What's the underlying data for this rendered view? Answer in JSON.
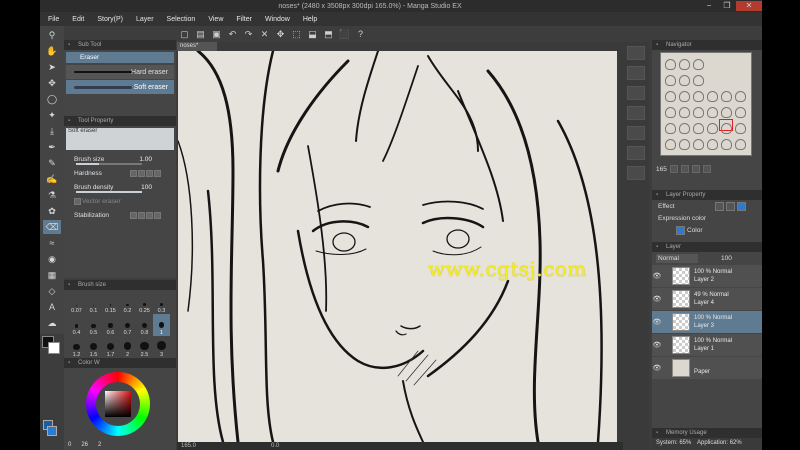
{
  "window": {
    "title": "noses* (2480 x 3508px 300dpi 165.0%) - Manga Studio EX",
    "controls": [
      "−",
      "❐",
      "✕"
    ]
  },
  "menu": [
    "File",
    "Edit",
    "Story(P)",
    "Layer",
    "Selection",
    "View",
    "Filter",
    "Window",
    "Help"
  ],
  "subtool": {
    "header": "Sub Tool",
    "tab": "Eraser",
    "items": [
      {
        "label": "Hard eraser",
        "selected": false
      },
      {
        "label": "Soft eraser",
        "selected": true
      }
    ]
  },
  "tool_property": {
    "header": "Tool Property",
    "preview_label": "Soft eraser",
    "brush_size": {
      "label": "Brush size",
      "value": "1.00",
      "fraction": 0.35
    },
    "hardness": {
      "label": "Hardness"
    },
    "brush_density": {
      "label": "Brush density",
      "value": "100",
      "fraction": 1.0
    },
    "vector_eraser": {
      "label": "Vector eraser"
    },
    "stabilization": {
      "label": "Stabilization"
    }
  },
  "brush_size_panel": {
    "header": "Brush size",
    "sizes": [
      "0.07",
      "0.1",
      "0.15",
      "0.2",
      "0.25",
      "0.3",
      "0.4",
      "0.5",
      "0.6",
      "0.7",
      "0.8",
      "1",
      "1.2",
      "1.5",
      "1.7",
      "2",
      "2.5",
      "3"
    ],
    "selected": "1"
  },
  "color_panel": {
    "header": "Color W",
    "h": "0",
    "s": "26",
    "v": "2"
  },
  "canvas": {
    "tab": "noses*",
    "zoom": "165.0",
    "angle": "0.0",
    "watermark": "www.cgtsj.com"
  },
  "navigator": {
    "header": "Navigator",
    "zoom": "165"
  },
  "layer_property": {
    "header": "Layer Property",
    "effect_label": "Effect",
    "expression_label": "Expression color",
    "color_value": "Color"
  },
  "layer_panel": {
    "header": "Layer",
    "blend_mode": "Normal",
    "opacity": "100",
    "layers": [
      {
        "opacity": "100 %",
        "mode": "Normal",
        "name": "Layer 2",
        "selected": false,
        "thumb": "transparent"
      },
      {
        "opacity": "49 %",
        "mode": "Normal",
        "name": "Layer 4",
        "selected": false,
        "thumb": "sketch"
      },
      {
        "opacity": "100 %",
        "mode": "Normal",
        "name": "Layer 3",
        "selected": true,
        "thumb": "transparent"
      },
      {
        "opacity": "100 %",
        "mode": "Normal",
        "name": "Layer 1",
        "selected": false,
        "thumb": "transparent"
      },
      {
        "opacity": "",
        "mode": "",
        "name": "Paper",
        "selected": false,
        "thumb": "paper"
      }
    ]
  },
  "memory": {
    "header": "Memory Usage",
    "system": "System: 65%",
    "application": "Application: 62%"
  },
  "colors": {
    "accent": "#5e7b92",
    "panel": "#454545",
    "canvas_paper": "#e6e3dc",
    "watermark": "#f4ef1c"
  }
}
